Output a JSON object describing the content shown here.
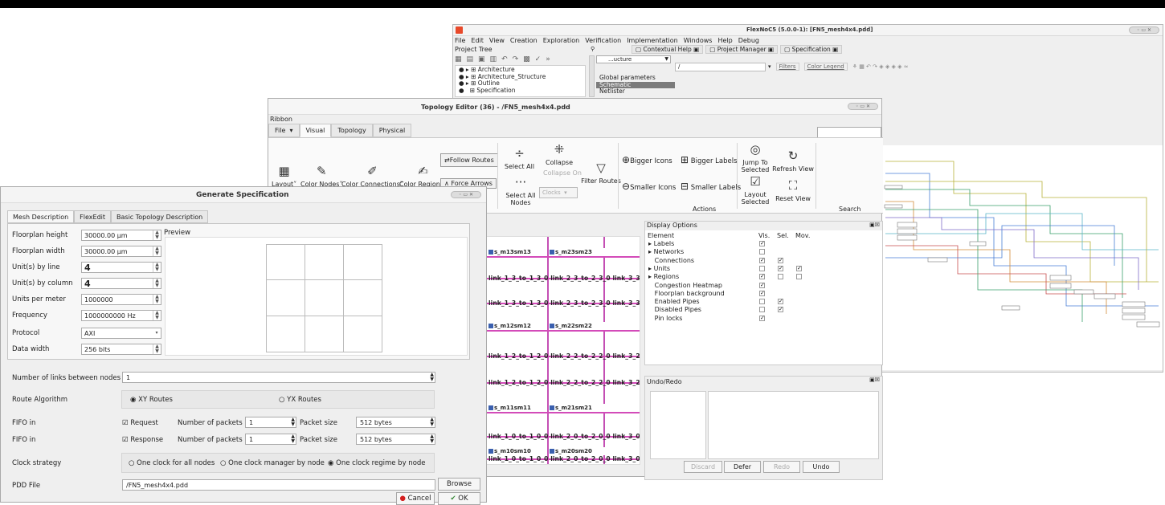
{
  "main_window": {
    "title": "FlexNoC5 (5.0.0-1): [FN5_mesh4x4.pdd]",
    "menus": [
      "File",
      "Edit",
      "View",
      "Creation",
      "Exploration",
      "Verification",
      "Implementation",
      "Windows",
      "Help",
      "Debug"
    ],
    "project_tree_label": "Project Tree",
    "tabs": [
      "Contextual Help",
      "Project Manager",
      "Specification"
    ],
    "tree_items": [
      "Architecture",
      "Architecture_Structure",
      "Outline",
      "Specification"
    ],
    "view_combo": "...ucture",
    "spec_side_label": "Specification",
    "spec_list": [
      "Global parameters",
      "Schematic",
      "Netlister"
    ],
    "path_input": "/",
    "filters_label": "Filters",
    "color_legend_label": "Color Legend"
  },
  "topology_editor": {
    "title": "Topology Editor (36) - /FN5_mesh4x4.pdd",
    "ribbon_label": "Ribbon",
    "tabs": [
      "File",
      "Visual",
      "Topology",
      "Physical"
    ],
    "buttons": {
      "layout": "Layout",
      "color_nodes": "Color Nodes",
      "color_connections": "Color Connections",
      "color_regions": "Color Regions",
      "follow_routes": "Follow Routes",
      "force_arrows": "Force Arrows",
      "select_all": "Select All",
      "select_all_nodes": "Select All Nodes",
      "collapse": "Collapse",
      "collapse_on": "Collapse On",
      "clocks": "Clocks",
      "filter_routes": "Filter Routes",
      "bigger_icons": "Bigger Icons",
      "smaller_icons": "Smaller Icons",
      "bigger_labels": "Bigger Labels",
      "smaller_labels": "Smaller Labels",
      "jump_to_selected": "Jump To Selected",
      "layout_selected": "Layout Selected",
      "refresh_view": "Refresh View",
      "reset_view": "Reset View",
      "actions_section": "Actions",
      "search_section": "Search"
    },
    "display_options": {
      "header": "Display Options",
      "columns": [
        "Element",
        "Vis.",
        "Sel.",
        "Mov."
      ],
      "rows": [
        {
          "label": "Labels",
          "expand": true,
          "vis": true,
          "sel": null,
          "mov": null
        },
        {
          "label": "Networks",
          "expand": true,
          "vis": false,
          "sel": null,
          "mov": null
        },
        {
          "label": "Connections",
          "expand": false,
          "vis": true,
          "sel": true,
          "mov": null
        },
        {
          "label": "Units",
          "expand": true,
          "vis": false,
          "sel": true,
          "mov": true
        },
        {
          "label": "Regions",
          "expand": true,
          "vis": true,
          "sel": false,
          "mov": false
        },
        {
          "label": "Congestion Heatmap",
          "expand": false,
          "vis": true,
          "sel": null,
          "mov": null
        },
        {
          "label": "Floorplan background",
          "expand": false,
          "vis": true,
          "sel": null,
          "mov": null
        },
        {
          "label": "Enabled Pipes",
          "expand": false,
          "vis": false,
          "sel": true,
          "mov": null
        },
        {
          "label": "Disabled Pipes",
          "expand": false,
          "vis": false,
          "sel": true,
          "mov": null
        },
        {
          "label": "Pin locks",
          "expand": false,
          "vis": true,
          "sel": null,
          "mov": null
        }
      ]
    },
    "undo": {
      "header": "Undo/Redo",
      "discard": "Discard",
      "defer": "Defer",
      "redo": "Redo",
      "undo": "Undo"
    },
    "canvas_links": [
      "link_1_3_to_1_3_0",
      "link_2_3_to_2_3_0",
      "link_3_3",
      "link_1_2_to_1_2_0",
      "link_2_2_to_2_2_0",
      "link_3_2",
      "link_1_0_to_1_0_0",
      "link_2_0_to_2_0_0",
      "link_3_0"
    ],
    "canvas_nodes": [
      "s_m13sm13",
      "s_m23sm23",
      "s_m12sm12",
      "s_m22sm22",
      "s_m11sm11",
      "s_m21sm21",
      "s_m10sm10",
      "s_m20sm20"
    ]
  },
  "generate_spec": {
    "title": "Generate Specification",
    "tabs": [
      "Mesh Description",
      "FlexEdit",
      "Basic Topology Description"
    ],
    "fields": {
      "floorplan_height_label": "Floorplan height",
      "floorplan_height": "30000.00 µm",
      "floorplan_width_label": "Floorplan width",
      "floorplan_width": "30000.00 µm",
      "units_by_line_label": "Unit(s) by line",
      "units_by_line": "4",
      "units_by_column_label": "Unit(s) by column",
      "units_by_column": "4",
      "units_per_meter_label": "Units per meter",
      "units_per_meter": "1000000",
      "frequency_label": "Frequency",
      "frequency": "1000000000 Hz",
      "protocol_label": "Protocol",
      "protocol": "AXI",
      "data_width_label": "Data width",
      "data_width": "256 bits"
    },
    "preview_label": "Preview",
    "links_label": "Number of links between nodes",
    "links_value": "1",
    "route_label": "Route Algorithm",
    "route_xy": "XY Routes",
    "route_yx": "YX Routes",
    "fifo1_label": "FIFO in",
    "fifo1_kind": "Request",
    "fifo2_label": "FIFO in",
    "fifo2_kind": "Response",
    "packets_label": "Number of packets",
    "packets_value": "1",
    "packet_size_label": "Packet size",
    "packet_size_value": "512 bytes",
    "clock_label": "Clock strategy",
    "clock_opt1": "One clock for all nodes",
    "clock_opt2": "One clock manager by node",
    "clock_opt3": "One clock regime by node",
    "pdd_label": "PDD File",
    "pdd_value": "/FN5_mesh4x4.pdd",
    "browse": "Browse",
    "cancel": "Cancel",
    "ok": "OK"
  },
  "colors": {
    "accent_pink": "#c44fb4",
    "node_blue": "#3a5fae",
    "app_red": "#e8492a"
  }
}
